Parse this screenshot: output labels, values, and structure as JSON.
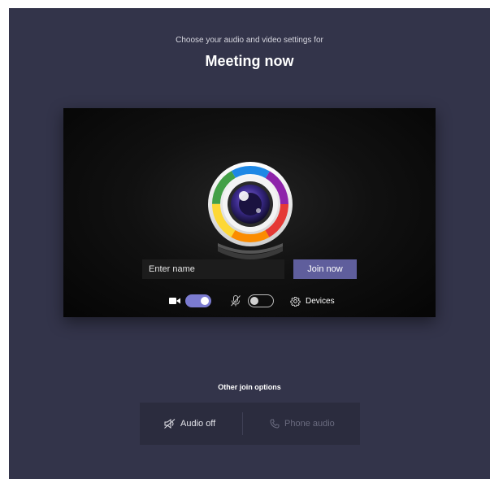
{
  "header": {
    "subtitle": "Choose your audio and video settings for",
    "meeting_title": "Meeting now"
  },
  "preview": {
    "name_input": {
      "value": "",
      "placeholder": "Enter name"
    },
    "join_button": {
      "label": "Join now"
    },
    "camera_toggle": {
      "icon": "video-camera-icon",
      "state": "on"
    },
    "mic_toggle": {
      "icon": "mic-off-icon",
      "state": "off"
    },
    "devices_button": {
      "icon": "gear-icon",
      "label": "Devices"
    }
  },
  "other_join_options": {
    "label": "Other join options",
    "audio_off": {
      "icon": "speaker-off-icon",
      "label": "Audio off"
    },
    "phone_audio": {
      "icon": "phone-icon",
      "label": "Phone audio"
    }
  },
  "colors": {
    "background": "#33344a",
    "accent": "#5f5e9c",
    "toggle_on": "#7b7bd0",
    "options_box": "#2b2c3e"
  }
}
